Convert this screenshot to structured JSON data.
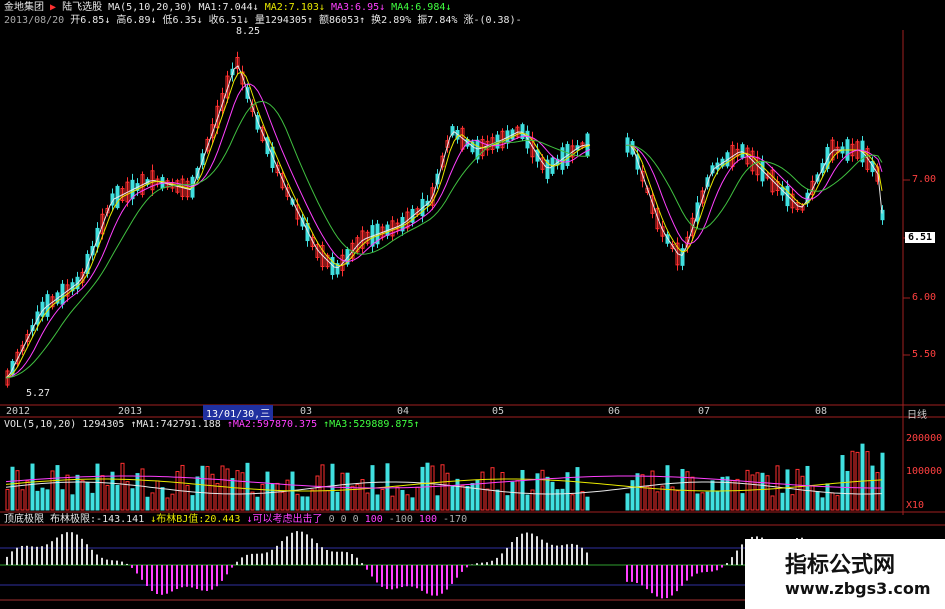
{
  "header": {
    "stock_name": "金地集团",
    "indicator": "陆飞选股",
    "ma_label": "MA(5,10,20,30)",
    "ma1": "MA1:7.044↓",
    "ma2": "MA2:7.103↓",
    "ma3": "MA3:6.95↓",
    "ma4": "MA4:6.984↓",
    "date": "2013/08/20",
    "open": "开6.85↓",
    "high": "高6.89↓",
    "low": "低6.35↓",
    "close": "收6.51↓",
    "volume": "量1294305↑",
    "amount": "额86053↑",
    "turnover": "换2.89%",
    "amplitude": "振7.84%",
    "change": "涨-(0.38)-"
  },
  "price_axis": {
    "labels": [
      "7.00",
      "6.00",
      "5.50"
    ],
    "current": "6.51"
  },
  "annotations": {
    "high": "8.25",
    "low": "5.27"
  },
  "x_axis": {
    "labels": [
      "2012",
      "2013",
      "03",
      "04",
      "05",
      "06",
      "07",
      "08"
    ],
    "tooltip": "13/01/30,三",
    "right_label": "日线"
  },
  "volume_panel": {
    "title": "VOL(5,10,20)",
    "value": "1294305",
    "ma1": "↑MA1:742791.188",
    "ma2": "↑MA2:597870.375",
    "ma3": "↑MA3:529889.875↑",
    "axis": [
      "200000",
      "100000",
      "X10"
    ]
  },
  "indicator_panel": {
    "title": "顶底极限",
    "name": "布林极限",
    "value": ":-143.141",
    "name2": "↓布林BJ值",
    "value2": ":20.443",
    "signal": "↓可以考虑出击了",
    "levels": "0 0 0",
    "level2": "100",
    "level3": "-100",
    "level4": "100",
    "level5": "-170"
  },
  "watermark": {
    "title": "指标公式网",
    "url": "www.zbgs3.com"
  },
  "colors": {
    "up": "#ff3030",
    "down": "#40e0e0",
    "ma1": "#e8e8e8",
    "ma2": "#e8e800",
    "ma3": "#ff40ff",
    "ma4": "#40c040"
  }
}
